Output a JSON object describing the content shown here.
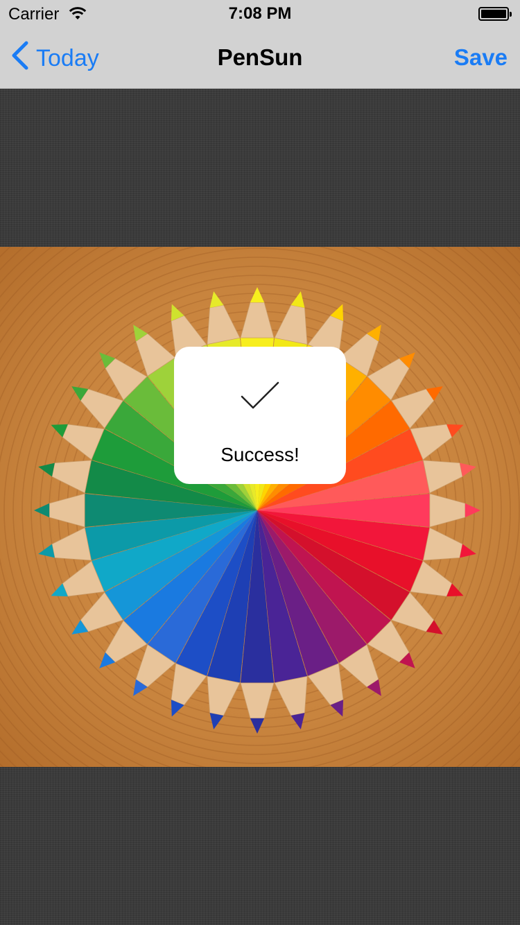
{
  "status_bar": {
    "carrier": "Carrier",
    "time": "7:08 PM"
  },
  "nav": {
    "back_label": "Today",
    "title": "PenSun",
    "save_label": "Save"
  },
  "hud": {
    "message": "Success!",
    "icon": "checkmark-icon"
  },
  "photo": {
    "subject": "colored-pencils-wheel",
    "pencil_colors": [
      "#f7ee1e",
      "#f2e816",
      "#ffd400",
      "#ffb000",
      "#ff8c00",
      "#ff6a00",
      "#ff4b1f",
      "#ff5a5a",
      "#ff3a5c",
      "#f2163a",
      "#e8102a",
      "#d4102c",
      "#c01450",
      "#9c1a6a",
      "#6a1f86",
      "#4a2496",
      "#2a2f9e",
      "#1e3fb4",
      "#1d4ec6",
      "#2a6ad8",
      "#1a7ae0",
      "#1596d8",
      "#10a8c8",
      "#0c9aa8",
      "#0e8a72",
      "#138a48",
      "#1e9c3a",
      "#3aa83a",
      "#6abc3a",
      "#9ed23a",
      "#cfe22e",
      "#e6ea2a"
    ],
    "wood_color": "#c8843e"
  },
  "colors": {
    "accent": "#1a7cf5",
    "bar_background": "#d2d2d2",
    "linen": "#3b3b3b"
  }
}
